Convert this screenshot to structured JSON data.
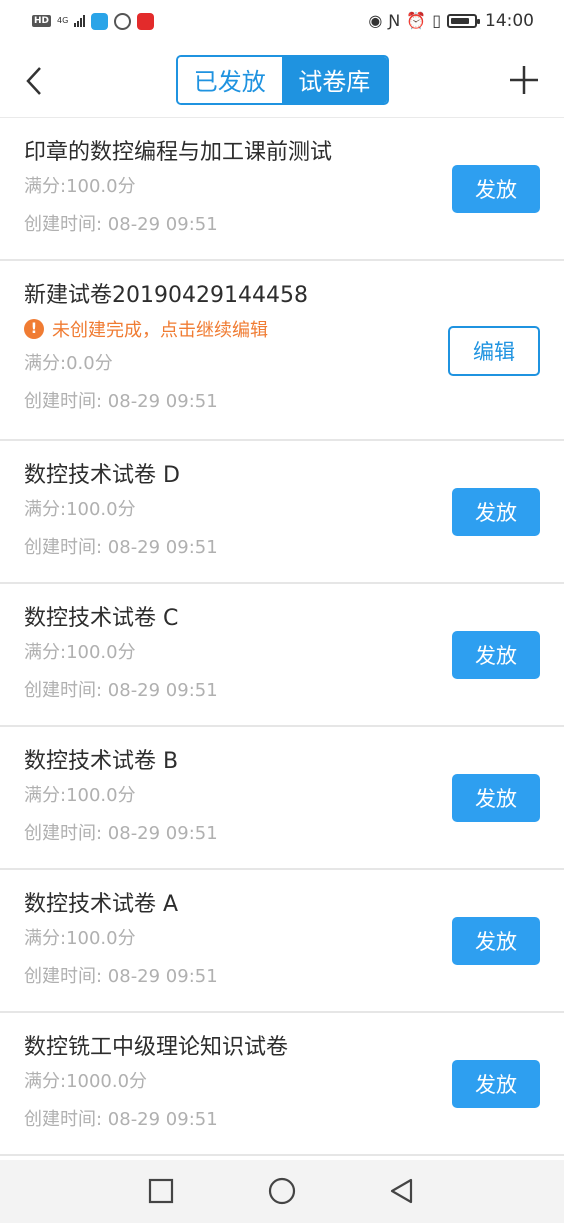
{
  "status_bar": {
    "hd": "HD",
    "network": "4G",
    "time": "14:00",
    "battery_level": 0.8,
    "icons": [
      "eye-icon",
      "nfc-icon",
      "alarm-icon",
      "vibrate-icon",
      "battery-icon"
    ]
  },
  "header": {
    "tabs": [
      {
        "label": "已发放",
        "active": false
      },
      {
        "label": "试卷库",
        "active": true
      }
    ],
    "back_icon": "chevron-left-icon",
    "add_icon": "plus-icon"
  },
  "papers": [
    {
      "title": "印章的数控编程与加工课前测试",
      "score": "满分:100.0分",
      "created": "创建时间: 08-29 09:51",
      "action": "发放"
    },
    {
      "title": "新建试卷20190429144458",
      "warning": "未创建完成，点击继续编辑",
      "score": "满分:0.0分",
      "created": "创建时间: 08-29 09:51",
      "action": "编辑"
    },
    {
      "title": "数控技术试卷 D",
      "score": "满分:100.0分",
      "created": "创建时间: 08-29 09:51",
      "action": "发放"
    },
    {
      "title": "数控技术试卷 C",
      "score": "满分:100.0分",
      "created": "创建时间: 08-29 09:51",
      "action": "发放"
    },
    {
      "title": "数控技术试卷 B",
      "score": "满分:100.0分",
      "created": "创建时间: 08-29 09:51",
      "action": "发放"
    },
    {
      "title": "数控技术试卷 A",
      "score": "满分:100.0分",
      "created": "创建时间: 08-29 09:51",
      "action": "发放"
    },
    {
      "title": "数控铣工中级理论知识试卷",
      "score": "满分:1000.0分",
      "created": "创建时间: 08-29 09:51",
      "action": "发放"
    }
  ],
  "colors": {
    "accent": "#1f93e0",
    "button": "#2e9ff0",
    "warning": "#f07c33",
    "meta_text": "#b0b0b0"
  },
  "nav_bar": {
    "buttons": [
      "square-recents-icon",
      "circle-home-icon",
      "triangle-back-icon"
    ]
  }
}
